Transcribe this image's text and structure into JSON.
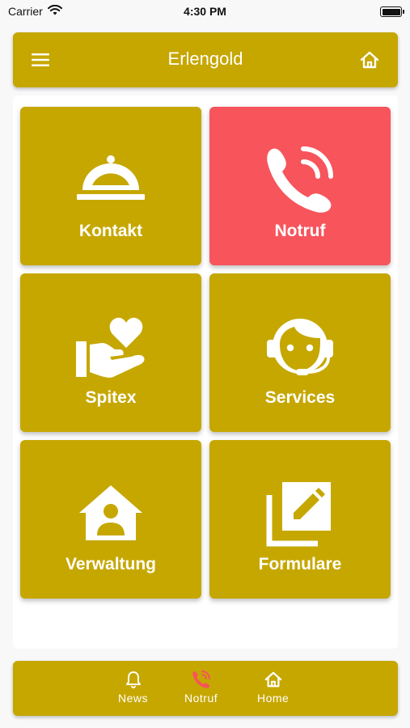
{
  "status_bar": {
    "carrier": "Carrier",
    "time": "4:30 PM"
  },
  "header": {
    "title": "Erlengold",
    "menu_icon": "menu-icon",
    "home_icon": "home-icon"
  },
  "tiles": [
    {
      "label": "Kontakt",
      "icon": "cloche-icon",
      "color": "#c6a700"
    },
    {
      "label": "Notruf",
      "icon": "phone-ringing-icon",
      "color": "#f7545c"
    },
    {
      "label": "Spitex",
      "icon": "hand-heart-icon",
      "color": "#c6a700"
    },
    {
      "label": "Services",
      "icon": "headset-person-icon",
      "color": "#c6a700"
    },
    {
      "label": "Verwaltung",
      "icon": "house-person-icon",
      "color": "#c6a700"
    },
    {
      "label": "Formulare",
      "icon": "edit-form-icon",
      "color": "#c6a700"
    }
  ],
  "bottom_nav": [
    {
      "label": "News",
      "icon": "bell-icon"
    },
    {
      "label": "Notruf",
      "icon": "phone-icon",
      "icon_color": "#f7545c"
    },
    {
      "label": "Home",
      "icon": "home-icon"
    }
  ],
  "colors": {
    "accent": "#c6a700",
    "emergency": "#f7545c",
    "background": "#f8f8f8"
  }
}
